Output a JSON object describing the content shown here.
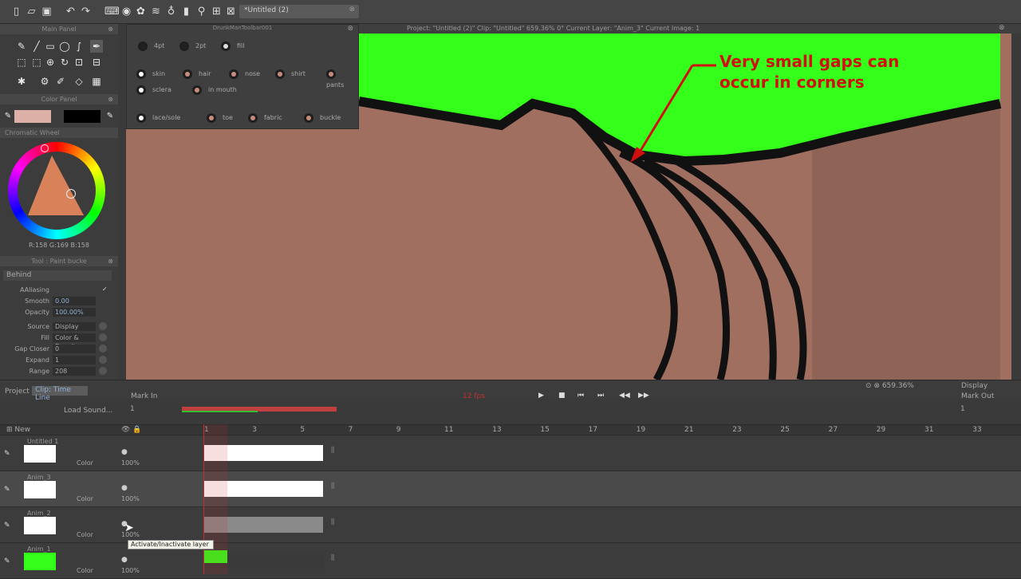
{
  "document": {
    "tab_title": "*Untitled (2)"
  },
  "status": {
    "text": "Project:  \"Untitled (2)\"  Clip: \"Untitled\"   659.36%   0°  Current Layer: \"Anim_3\"  Current Image: 1"
  },
  "panels": {
    "main_panel": "Main Panel",
    "color_panel": "Color Panel",
    "chromatic_wheel": "Chromatic Wheel",
    "rgb_readout": "R:158 G:169 B:158",
    "tool_panel": "Tool : Paint bucke",
    "drunkman": "DrunkManToolbar001"
  },
  "toolbar2": {
    "row1": [
      {
        "label": "4pt",
        "color": "#222222"
      },
      {
        "label": "2pt",
        "color": "#222222"
      },
      {
        "label": "fill",
        "color": "#dddddd"
      }
    ],
    "row2": [
      {
        "label": "skin",
        "color": "#ffffff"
      },
      {
        "label": "hair",
        "color": "#c98c7c"
      },
      {
        "label": "nose",
        "color": "#c98c7c"
      },
      {
        "label": "shirt",
        "color": "#c98c7c"
      },
      {
        "label": "pants",
        "color": "#c98c7c"
      }
    ],
    "row3": [
      {
        "label": "sclera",
        "color": "#ffffff"
      },
      {
        "label": "in mouth",
        "color": "#c98c7c"
      }
    ],
    "row4": [
      {
        "label": "lace/sole",
        "color": "#ffffff"
      },
      {
        "label": "toe",
        "color": "#c98c7c"
      },
      {
        "label": "fabric",
        "color": "#c98c7c"
      },
      {
        "label": "buckle",
        "color": "#c98c7c"
      }
    ]
  },
  "tool_props": {
    "section": "Behind",
    "aliasing": "AAliasing",
    "smooth": {
      "label": "Smooth",
      "value": "0.00"
    },
    "opacity": {
      "label": "Opacity",
      "value": "100.00%"
    },
    "source": {
      "label": "Source",
      "value": "Display"
    },
    "fill": {
      "label": "Fill",
      "value": "Color & Density"
    },
    "gap_closer": {
      "label": "Gap Closer",
      "value": "0"
    },
    "expand": {
      "label": "Expand",
      "value": "1"
    },
    "range": {
      "label": "Range",
      "value": "208"
    }
  },
  "annotation": {
    "line1": "Very small gaps can",
    "line2": "occur in corners"
  },
  "canvas_bar": {
    "zoom": "659.36%",
    "display": "Display",
    "project_tab": "Project",
    "clip_tab": "Clip: Time Line"
  },
  "timeline": {
    "mark_in": "Mark In",
    "mark_out": "Mark Out",
    "fps": "12 fps",
    "load_sound": "Load Sound...",
    "start_frame": "1",
    "end_frame": "1",
    "new_label": "New",
    "frame_numbers": [
      "1",
      "3",
      "5",
      "7",
      "9",
      "11",
      "13",
      "15",
      "17",
      "19",
      "21",
      "23",
      "25",
      "27",
      "29",
      "31",
      "33"
    ]
  },
  "layers": [
    {
      "name": "Untitled 1",
      "mode": "Color",
      "opacity": "100%"
    },
    {
      "name": "Anim_3",
      "mode": "Color",
      "opacity": "100%"
    },
    {
      "name": "Anim_2",
      "mode": "Color",
      "opacity": "100%"
    },
    {
      "name": "Anim_1",
      "mode": "Color",
      "opacity": "100%"
    }
  ],
  "tooltip": "Activate/Inactivate layer",
  "colors": {
    "canvas_bg": "#a06f60",
    "sky": "#33ff1a",
    "annotation": "#d01010",
    "panel_bg": "#3c3c3c"
  }
}
